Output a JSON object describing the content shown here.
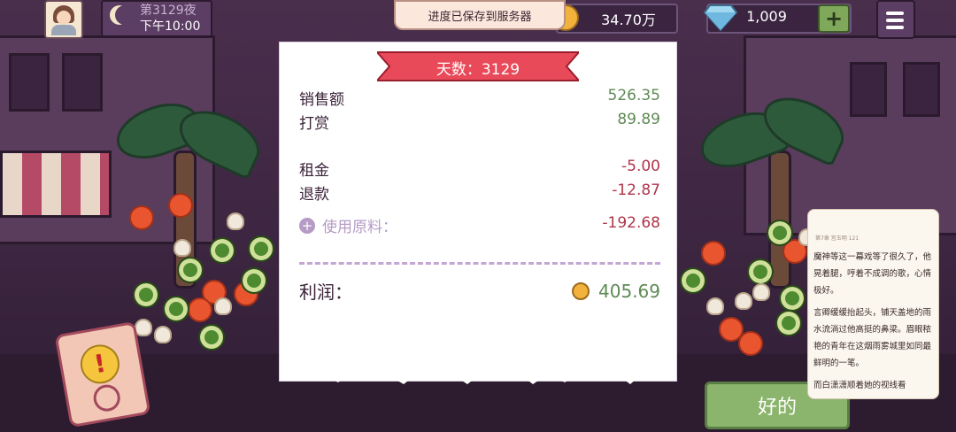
{
  "topbar": {
    "night_label": "第3129夜",
    "time_label": "下午10:00",
    "toast": "进度已保存到服务器",
    "coins": "34.70万",
    "gems": "1,009",
    "plus": "+"
  },
  "receipt": {
    "banner": "天数：3129",
    "rows": [
      {
        "label": "销售额",
        "value": "526.35"
      },
      {
        "label": "打赏",
        "value": "89.89"
      },
      {
        "label": "租金",
        "value": "-5.00"
      },
      {
        "label": "退款",
        "value": "-12.87"
      },
      {
        "label": "使用原料：",
        "value": "-192.68"
      }
    ],
    "profit_label": "利润：",
    "profit_value": "405.69"
  },
  "ok_button": "好的",
  "novel_popup": {
    "header": "第7章 宫玉明 121",
    "paragraphs": [
      "魔神等这一幕戏等了很久了，他晃着腿，哼着不成调的歌，心情极好。",
      "言卿缓缓抬起头，铺天盖地的雨水流淌过他高挺的鼻梁。眉眼秾艳的青年在这烟雨雾城里如同最鲜明的一笔。",
      "而白潇潇顺着她的视线看"
    ]
  },
  "colors": {
    "positive": "#5e8a54",
    "negative": "#b0354a",
    "banner": "#e84a5a",
    "ok_button": "#8bb46c"
  },
  "icons": [
    "avatar",
    "moon-icon",
    "coin-icon",
    "diamond-icon",
    "plus-icon",
    "menu-icon",
    "plus-circle-icon",
    "alert-icon"
  ]
}
